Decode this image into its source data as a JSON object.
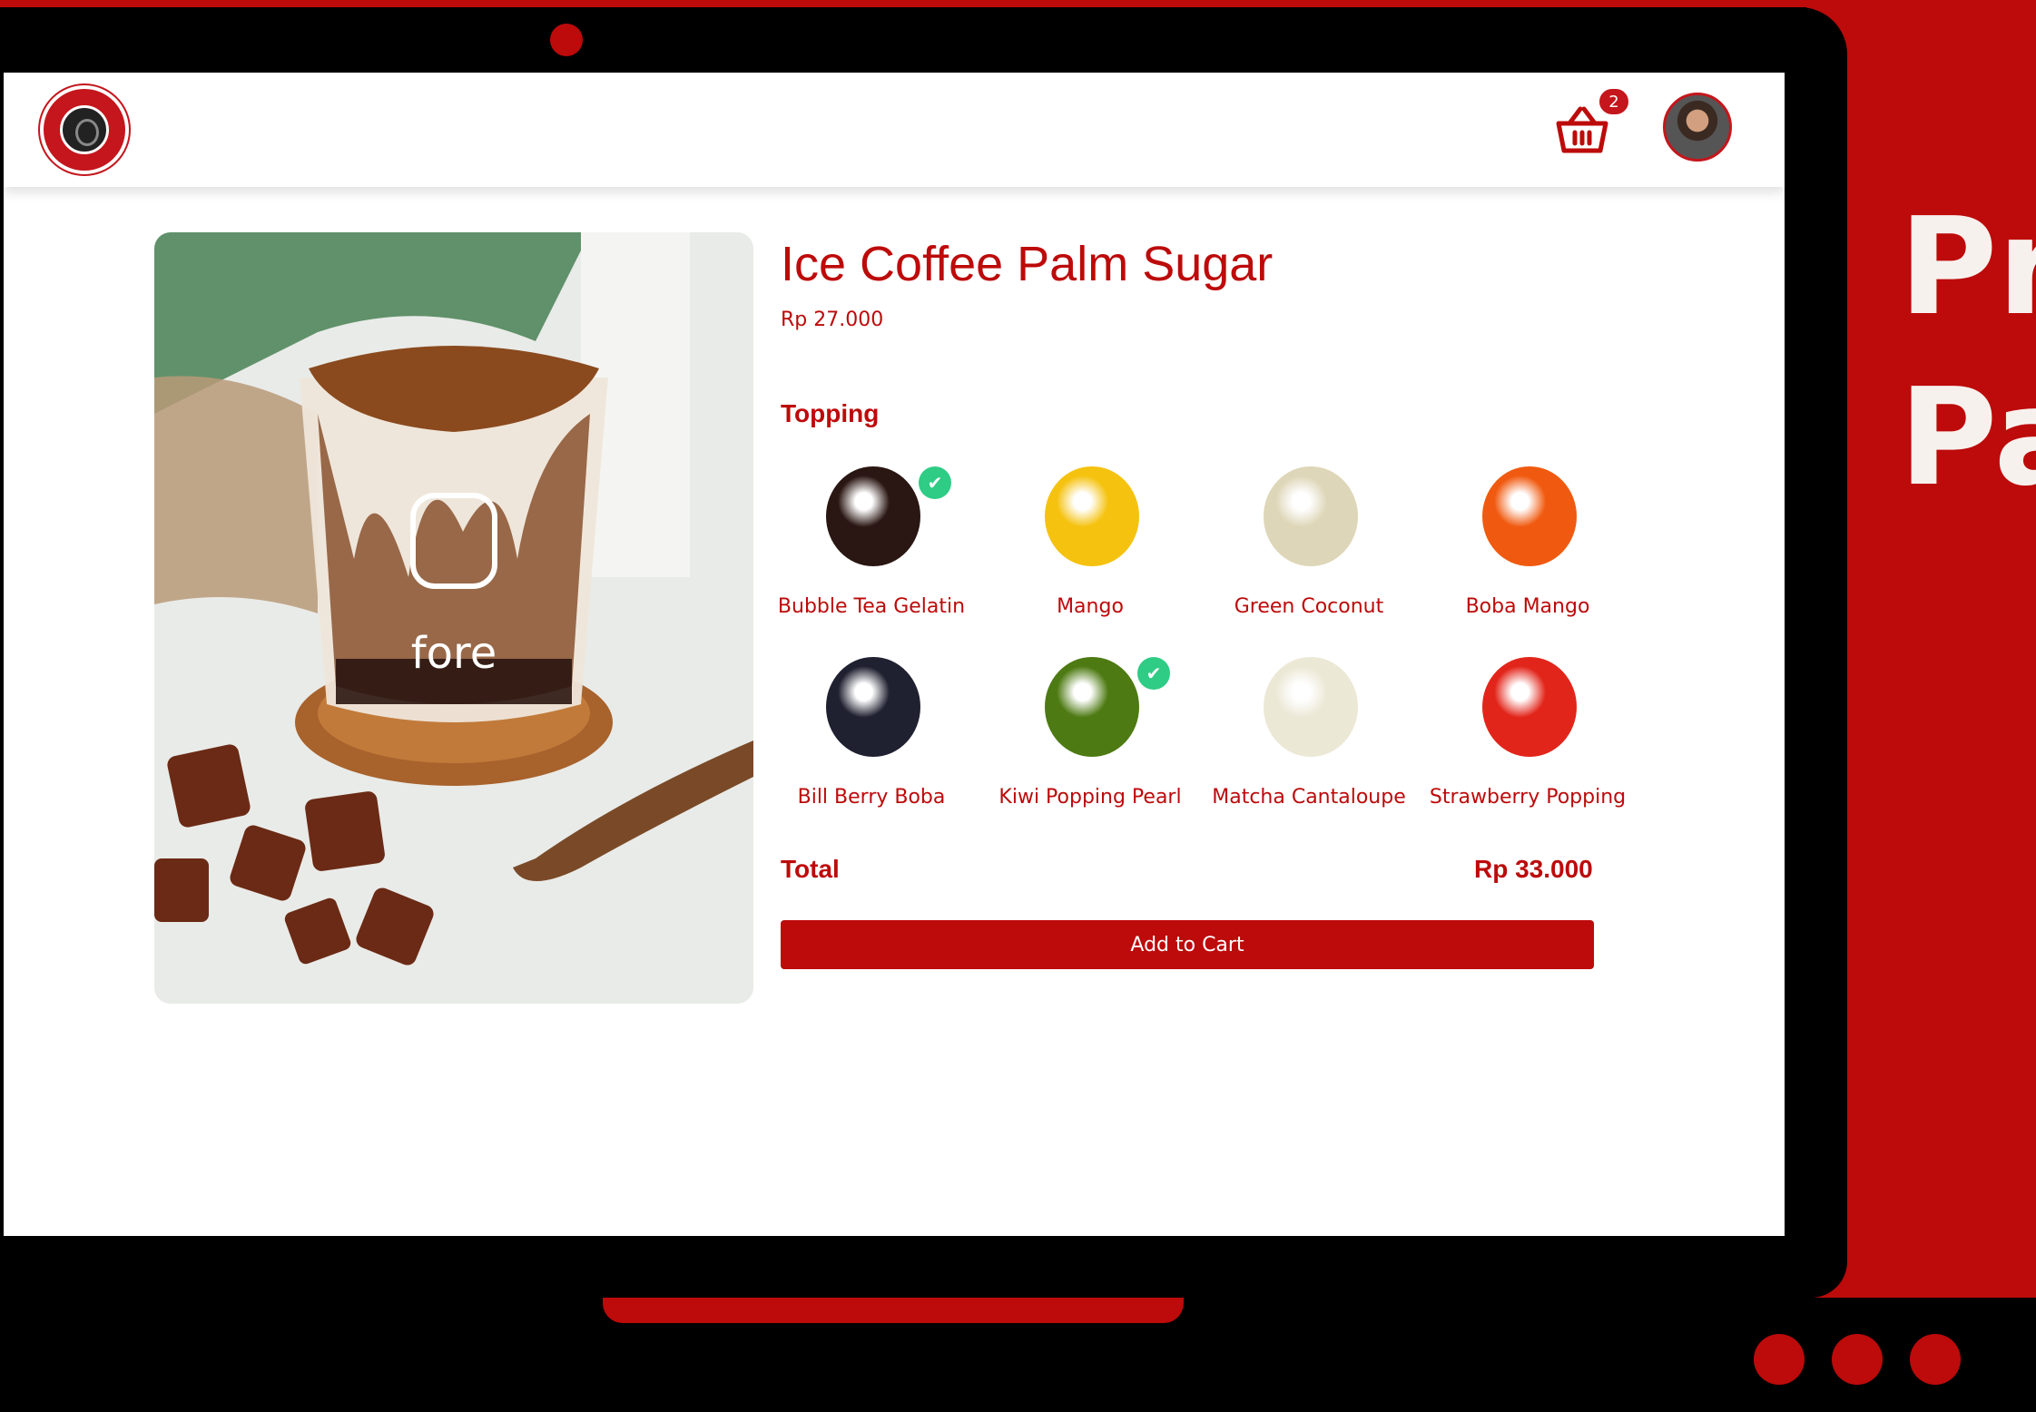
{
  "slide": {
    "side_title_line1": "Pr",
    "side_title_line2": "Pa"
  },
  "navbar": {
    "logo_icon": "waysbucks-coffee-logo",
    "cart_icon": "basket-icon",
    "cart_count": "2",
    "avatar_icon": "user-avatar"
  },
  "product": {
    "title": "Ice Coffee Palm Sugar",
    "price": "Rp 27.000",
    "image_icon": "ice-coffee-cup-image"
  },
  "topping": {
    "heading": "Topping",
    "items": [
      {
        "label": "Bubble Tea Gelatin",
        "selected": true,
        "color": "#2a1612"
      },
      {
        "label": "Mango",
        "selected": false,
        "color": "#f5c20f"
      },
      {
        "label": "Green Coconut",
        "selected": false,
        "color": "#ded6b8"
      },
      {
        "label": "Boba Mango",
        "selected": false,
        "color": "#f05a10"
      },
      {
        "label": "Bill Berry Boba",
        "selected": false,
        "color": "#1f2030"
      },
      {
        "label": "Kiwi Popping Pearl",
        "selected": true,
        "color": "#4d7a12"
      },
      {
        "label": "Matcha Cantaloupe",
        "selected": false,
        "color": "#ece8d6"
      },
      {
        "label": "Strawberry Popping",
        "selected": false,
        "color": "#e2251a"
      }
    ],
    "check_icon": "check-icon"
  },
  "total": {
    "label": "Total",
    "value": "Rp 33.000"
  },
  "actions": {
    "add_to_cart": "Add to Cart"
  },
  "colors": {
    "brand": "#bd0a0a",
    "check": "#2ecc85"
  }
}
